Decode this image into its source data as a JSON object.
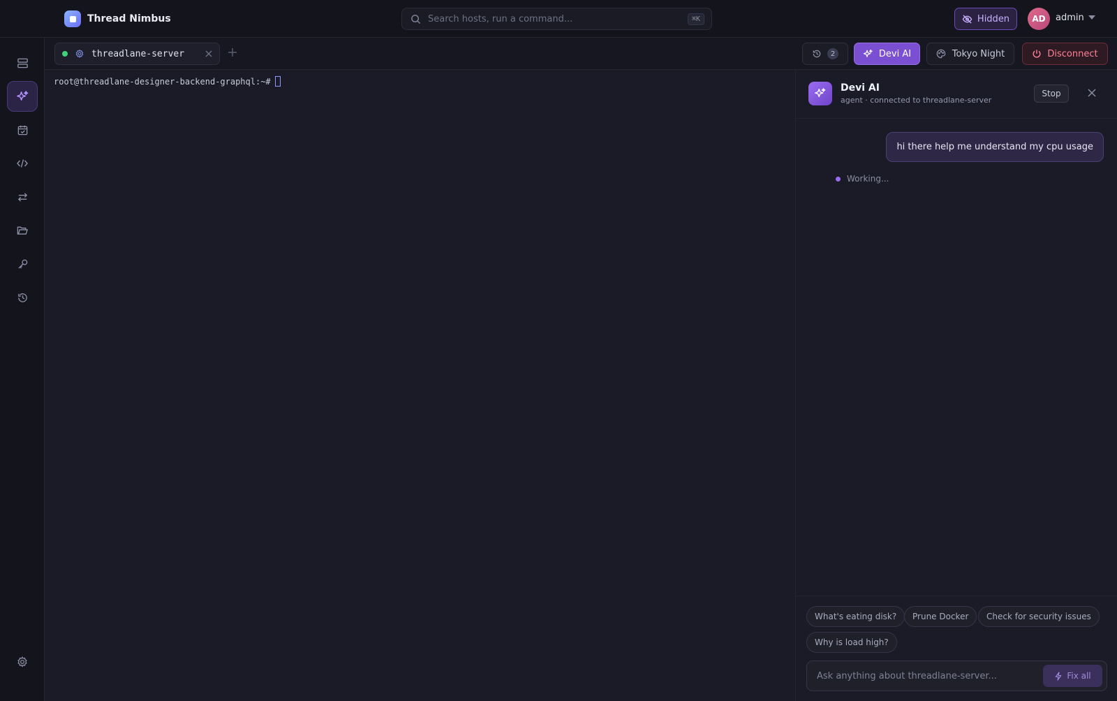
{
  "app": {
    "title": "Thread Nimbus",
    "accent": "#7a4fd1"
  },
  "topbar": {
    "search_placeholder": "Search hosts, run a command...",
    "search_shortcut": "⌘K",
    "hidden_label": "Hidden",
    "user_initials": "AD",
    "user_name": "admin"
  },
  "sidebar": {
    "items": [
      {
        "icon": "server-icon",
        "active": false
      },
      {
        "icon": "sparkles-icon",
        "active": true
      },
      {
        "icon": "calendar-check-icon",
        "active": false
      },
      {
        "icon": "code-icon",
        "active": false
      },
      {
        "icon": "transfer-icon",
        "active": false
      },
      {
        "icon": "folder-icon",
        "active": false
      },
      {
        "icon": "key-icon",
        "active": false
      },
      {
        "icon": "history-icon",
        "active": false
      }
    ],
    "footer_icon": "settings-icon"
  },
  "tabs": {
    "items": [
      {
        "label": "threadlane-server",
        "status": "connected",
        "status_color": "#3ed37a"
      }
    ],
    "history_count": "2",
    "devi_label": "Devi AI",
    "theme_label": "Tokyo Night",
    "disconnect_label": "Disconnect"
  },
  "terminal": {
    "prompt": "root@threadlane-designer-backend-graphql:~#"
  },
  "ai": {
    "title": "Devi AI",
    "subtitle": "agent · connected to threadlane-server",
    "stop_label": "Stop",
    "messages": [
      {
        "role": "user",
        "text": "hi there help me understand my cpu usage"
      }
    ],
    "status": "Working...",
    "suggestions": [
      "What's eating disk?",
      "Prune Docker",
      "Check for security issues",
      "Why is load high?"
    ],
    "input_placeholder": "Ask anything about threadlane-server...",
    "fix_label": "Fix all"
  }
}
